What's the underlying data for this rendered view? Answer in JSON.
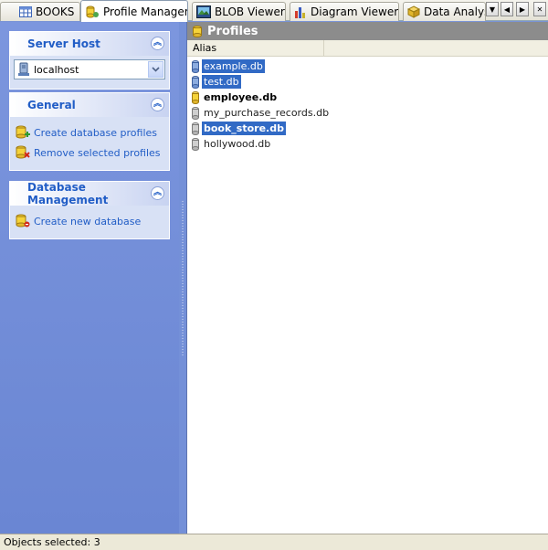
{
  "tabs": [
    {
      "label": "BOOKS",
      "icon": "table-icon"
    },
    {
      "label": "Profile Manager",
      "icon": "profile-manager-icon",
      "active": true
    },
    {
      "label": "BLOB Viewer",
      "icon": "image-icon"
    },
    {
      "label": "Diagram Viewer",
      "icon": "chart-icon"
    },
    {
      "label": "Data Analys",
      "icon": "cube-icon"
    }
  ],
  "tab_nav": {
    "dropdown": "▼",
    "prev": "◀",
    "next": "▶",
    "close": "✕"
  },
  "sidebar": {
    "server_host": {
      "title": "Server Host",
      "combo_value": "localhost"
    },
    "general": {
      "title": "General",
      "items": [
        {
          "label": "Create database profiles",
          "icon": "db-add-icon"
        },
        {
          "label": "Remove selected profiles",
          "icon": "db-remove-icon"
        }
      ]
    },
    "database_management": {
      "title": "Database Management",
      "items": [
        {
          "label": "Create new database",
          "icon": "db-new-icon"
        }
      ]
    }
  },
  "profiles": {
    "title": "Profiles",
    "column_alias": "Alias",
    "rows": [
      {
        "label": "example.db",
        "selected": true,
        "bold": false,
        "icon": "blue-db-icon"
      },
      {
        "label": "test.db",
        "selected": true,
        "bold": false,
        "icon": "blue-db-icon"
      },
      {
        "label": "employee.db",
        "selected": false,
        "bold": true,
        "icon": "yellow-db-icon"
      },
      {
        "label": "my_purchase_records.db",
        "selected": false,
        "bold": false,
        "icon": "gray-db-icon"
      },
      {
        "label": "book_store.db",
        "selected": true,
        "bold": true,
        "icon": "gray-db-icon"
      },
      {
        "label": "hollywood.db",
        "selected": false,
        "bold": false,
        "icon": "gray-db-icon"
      }
    ]
  },
  "status": {
    "text": "Objects selected: 3"
  },
  "colors": {
    "accent": "#215dc6",
    "selection": "#316ac5",
    "pane": "#7a93d6"
  }
}
